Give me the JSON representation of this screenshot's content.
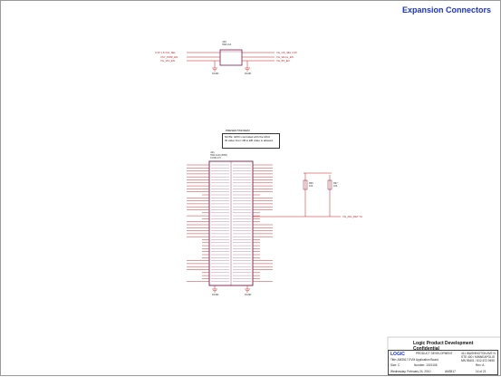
{
  "sheet_title": "Expansion Connectors",
  "confidential": "Logic Product Development Confidential",
  "note_box": {
    "label": "PRESENT/MODEM",
    "lines": [
      "NOTE: GPIO controlled with the MCU",
      "ID value from UB to EB video is allowed."
    ]
  },
  "title_block": {
    "company": "LOGIC",
    "dept": "PRODUCT DEVELOPMENT",
    "address": "411 WASHINGTON AVE N STE 400 / MINNEAPOLIS MN 55401 / 612.672.9495",
    "title_label": "Title:",
    "title_value": "AM3517 EVM Application Board",
    "size_label": "Size:",
    "size_value": "C",
    "doc_label": "Number:",
    "doc_value": "1019106",
    "rev_label": "Rev:",
    "rev_value": "A",
    "date": "Wednesday, February 24, 2010",
    "project": "AM3517",
    "sheet": "14 of 21"
  },
  "colors": {
    "title": "#1a33d6",
    "net": "#c41a1a",
    "wire": "#c41a1a",
    "part": "#7a1a4a",
    "frame": "#9a9a9a"
  }
}
